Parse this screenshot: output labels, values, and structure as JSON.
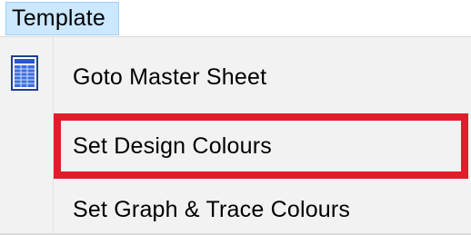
{
  "menubar": {
    "items": [
      {
        "label": "Template"
      }
    ]
  },
  "dropdown": {
    "items": [
      {
        "label": "Goto Master Sheet",
        "icon": "spreadsheet-icon"
      },
      {
        "label": "Set Design Colours",
        "highlighted": true
      },
      {
        "label": "Set Graph & Trace Colours"
      }
    ]
  },
  "colors": {
    "menubar_selected_bg": "#cce8ff",
    "menubar_selected_border": "#99d1ff",
    "highlight_annotation": "#e01e2b",
    "menu_bg": "#f2f2f2"
  }
}
